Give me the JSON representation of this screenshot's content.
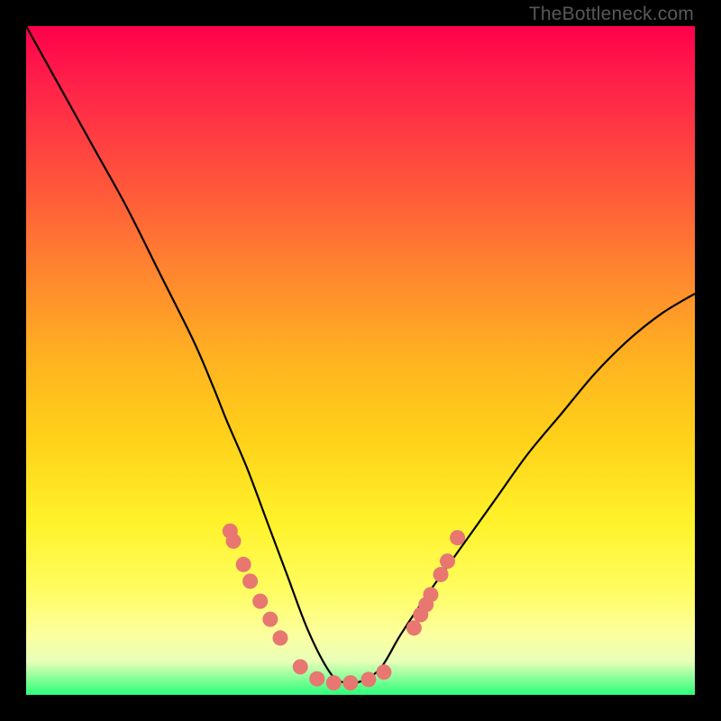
{
  "attribution": "TheBottleneck.com",
  "chart_data": {
    "type": "line",
    "title": "",
    "xlabel": "",
    "ylabel": "",
    "xlim": [
      0,
      100
    ],
    "ylim": [
      0,
      100
    ],
    "curve": {
      "description": "V-shaped bottleneck curve descending from top-left to a trough near x≈47 then rising toward the right",
      "x": [
        0,
        5,
        10,
        15,
        20,
        25,
        28,
        30,
        33,
        36,
        39,
        42,
        45,
        47,
        50,
        53,
        56,
        60,
        65,
        70,
        75,
        80,
        85,
        90,
        95,
        100
      ],
      "y": [
        100,
        91,
        82,
        73,
        63,
        53,
        46,
        41,
        34,
        26,
        18,
        10,
        4,
        2,
        2,
        4,
        9,
        15,
        22,
        29,
        36,
        42,
        48,
        53,
        57,
        60
      ]
    },
    "markers": {
      "description": "salmon-colored dots clustered near the trough and along both sides of the V in the lower region",
      "color": "#e77770",
      "points": [
        {
          "x": 30.5,
          "y": 24.5
        },
        {
          "x": 31.0,
          "y": 23.0
        },
        {
          "x": 32.5,
          "y": 19.5
        },
        {
          "x": 33.5,
          "y": 17.0
        },
        {
          "x": 35.0,
          "y": 14.0
        },
        {
          "x": 36.5,
          "y": 11.3
        },
        {
          "x": 38.0,
          "y": 8.5
        },
        {
          "x": 41.0,
          "y": 4.2
        },
        {
          "x": 43.5,
          "y": 2.4
        },
        {
          "x": 46.0,
          "y": 1.8
        },
        {
          "x": 48.5,
          "y": 1.8
        },
        {
          "x": 51.2,
          "y": 2.3
        },
        {
          "x": 53.5,
          "y": 3.4
        },
        {
          "x": 58.0,
          "y": 10.0
        },
        {
          "x": 59.0,
          "y": 12.0
        },
        {
          "x": 59.8,
          "y": 13.5
        },
        {
          "x": 60.5,
          "y": 15.0
        },
        {
          "x": 62.0,
          "y": 18.0
        },
        {
          "x": 63.0,
          "y": 20.0
        },
        {
          "x": 64.5,
          "y": 23.5
        }
      ]
    },
    "background_gradient": {
      "stops": [
        {
          "pct": 0,
          "color": "#ff004b"
        },
        {
          "pct": 50,
          "color": "#ffb320"
        },
        {
          "pct": 84,
          "color": "#fffd5e"
        },
        {
          "pct": 100,
          "color": "#2bff7a"
        }
      ]
    }
  }
}
